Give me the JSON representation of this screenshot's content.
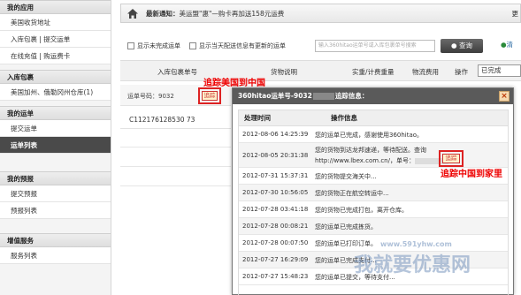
{
  "sidebar": {
    "sections": [
      {
        "title": "我的应用",
        "items": [
          "美国收货地址",
          "入库包裹 | 提交运单",
          "在线充值 | 购运费卡"
        ]
      },
      {
        "title": "入库包裹",
        "items": [
          "美国加州、俄勒冈州仓库(1)"
        ]
      },
      {
        "title": "我的运单",
        "items": [
          "提交运单",
          "运单列表"
        ]
      },
      {
        "title": "我的预报",
        "items": [
          "提交预报",
          "预报列表"
        ]
      },
      {
        "title": "增值服务",
        "items": [
          "服务列表"
        ]
      }
    ],
    "active_item": "运单列表"
  },
  "notice": {
    "label": "最新通知：",
    "text": "美运盟\"惠\"—购卡再加送158元运费",
    "more": "更"
  },
  "filter": {
    "checkbox1": "显示未完成运单",
    "checkbox2": "显示当天配送信息有更新的运单",
    "search_placeholder": "输入360hitao运单号或入库包裹单号搜索",
    "search_button": "查询",
    "clear_button": "清"
  },
  "table_headers": [
    "入库包裹单号",
    "货物说明",
    "实重/计费重量",
    "物流费用",
    "操作"
  ],
  "status_select": "已完成",
  "waybill": {
    "label": "运单号码：9032",
    "track_button": "追踪",
    "tracking_number": "C112176128530 73"
  },
  "annotations": {
    "to_china": "追踪美国到中国",
    "to_home": "追踪中国到家里"
  },
  "modal": {
    "title_prefix": "360hitao运单号-9032",
    "title_suffix": "追踪信息：",
    "close": "×",
    "col_time": "处理时间",
    "col_info": "操作信息",
    "rows": [
      {
        "time": "2012-08-06 14:25:39",
        "info": "您的运单已完成，感谢使用360hitao。"
      },
      {
        "time": "2012-08-05 20:31:38",
        "info": "您的货物到达龙邦速递，等待配送。查询",
        "info2": "http://www.lbex.com.cn/，单号：",
        "track": "追踪"
      },
      {
        "time": "2012-07-31 15:37:31",
        "info": "您的货物提交海关中..."
      },
      {
        "time": "2012-07-30 10:56:05",
        "info": "您的货物正在航空转运中..."
      },
      {
        "time": "2012-07-28 03:41:18",
        "info": "您的货物已完成打包，离开仓库。"
      },
      {
        "time": "2012-07-28 00:08:21",
        "info": "您的运单已完成拣货。"
      },
      {
        "time": "2012-07-28 00:07:50",
        "info": "您的运单已打印订单。"
      },
      {
        "time": "2012-07-27 16:29:09",
        "info": "您的运单已完成支付..."
      },
      {
        "time": "2012-07-27 15:48:23",
        "info": "您的运单已提交，等待支付..."
      }
    ]
  },
  "watermark": {
    "text": "我就要优惠网",
    "url": "www.591yhw.com"
  }
}
